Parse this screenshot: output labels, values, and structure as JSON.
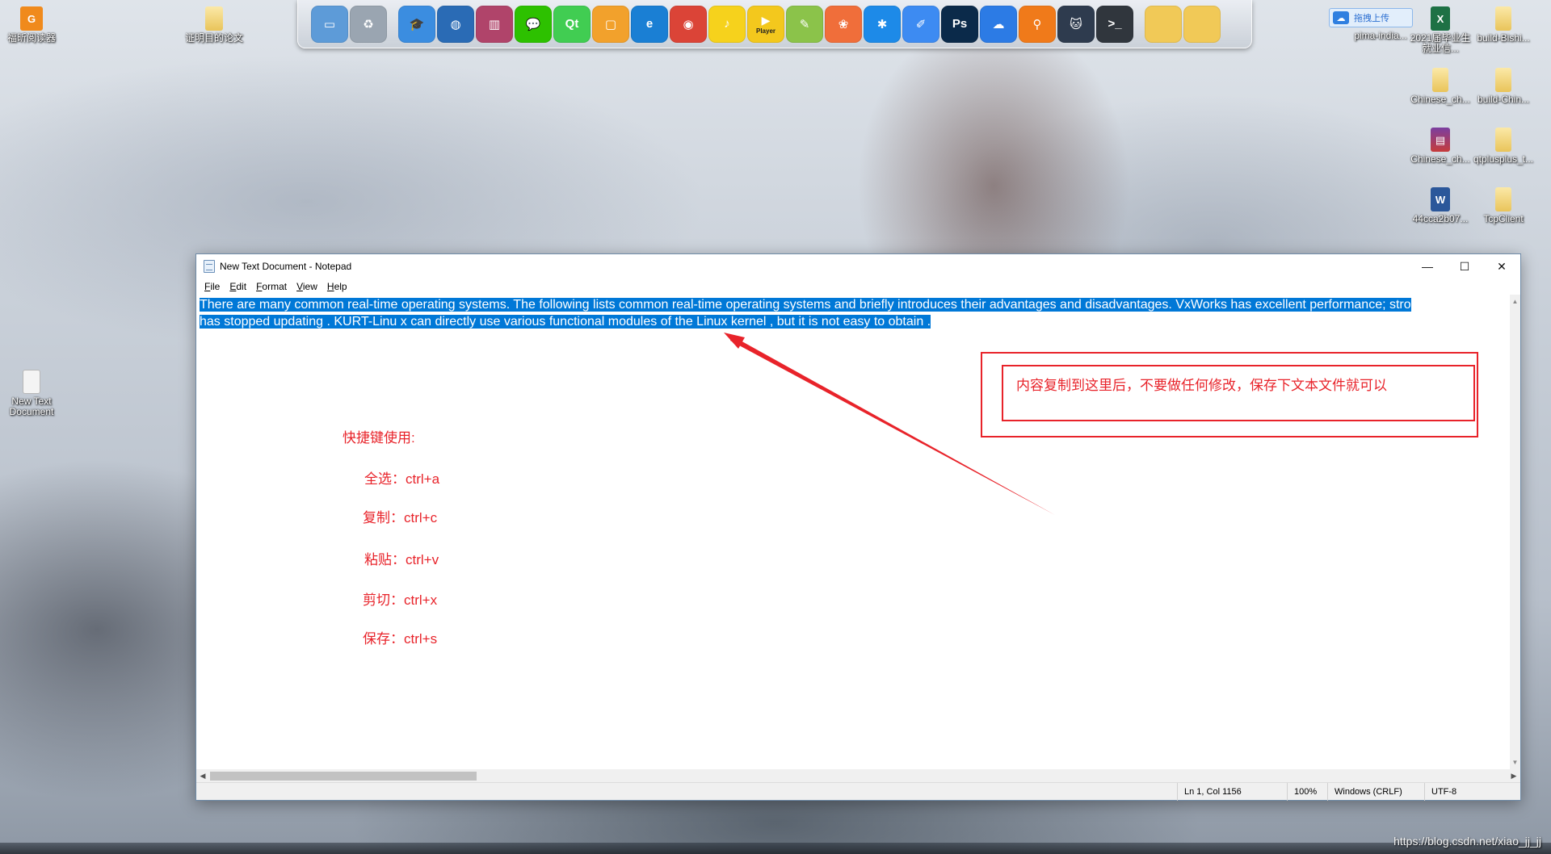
{
  "desktop": {
    "icons_left": [
      {
        "label": "福昕阅读器",
        "glyph": "G",
        "kind": "foxit"
      },
      {
        "label": "证明目的论文",
        "glyph": "",
        "kind": "folder"
      },
      {
        "label": "New Text Document",
        "glyph": "",
        "kind": "doc"
      }
    ],
    "icons_right": [
      {
        "label": "拖拽上传",
        "glyph": "☁",
        "kind": "cloud"
      },
      {
        "label": "pima-india...",
        "glyph": "",
        "kind": "folder"
      },
      {
        "label": "2021届毕业生就业信...",
        "glyph": "X",
        "kind": "excel"
      },
      {
        "label": "build-Bishi...",
        "glyph": "",
        "kind": "folder"
      },
      {
        "label": "Chinese_ch...",
        "glyph": "",
        "kind": "folder"
      },
      {
        "label": "build-Chin...",
        "glyph": "",
        "kind": "folder"
      },
      {
        "label": "Chinese_ch...",
        "glyph": "▤",
        "kind": "rar"
      },
      {
        "label": "qtplusplus_t...",
        "glyph": "",
        "kind": "folder"
      },
      {
        "label": "44cca2b07...",
        "glyph": "W",
        "kind": "word"
      },
      {
        "label": "TcpClient",
        "glyph": "",
        "kind": "folder"
      }
    ]
  },
  "dock": {
    "icons": [
      {
        "name": "computer-icon",
        "glyph": "▭",
        "color": "#5d9bd8"
      },
      {
        "name": "recycle-bin-icon",
        "glyph": "♻",
        "color": "#9aa5b1"
      },
      {
        "name": "sep"
      },
      {
        "name": "graduation-cap-icon",
        "glyph": "🎓",
        "color": "#3b8de0"
      },
      {
        "name": "network-globe-icon",
        "glyph": "◍",
        "color": "#2a6bb5"
      },
      {
        "name": "books-icon",
        "glyph": "▥",
        "color": "#b0446a"
      },
      {
        "name": "wechat-icon",
        "glyph": "💬",
        "color": "#2dc100"
      },
      {
        "name": "qt-icon",
        "glyph": "Qt",
        "color": "#41cd52"
      },
      {
        "name": "box-app-icon",
        "glyph": "▢",
        "color": "#f2a12c"
      },
      {
        "name": "edge-icon",
        "glyph": "e",
        "color": "#1a7fd4"
      },
      {
        "name": "chrome-icon",
        "glyph": "◉",
        "color": "#db4437"
      },
      {
        "name": "music-icon",
        "glyph": "♪",
        "color": "#f6d21c"
      },
      {
        "name": "potplayer-icon",
        "glyph": "▶",
        "color": "#f3c81d",
        "label": "Player"
      },
      {
        "name": "notepadpp-icon",
        "glyph": "✎",
        "color": "#8bc34a"
      },
      {
        "name": "photos-icon",
        "glyph": "❀",
        "color": "#f06e3a"
      },
      {
        "name": "star-app-icon",
        "glyph": "✱",
        "color": "#1d8ae8"
      },
      {
        "name": "pen-app-icon",
        "glyph": "✐",
        "color": "#3d8bf2"
      },
      {
        "name": "photoshop-icon",
        "glyph": "Ps",
        "color": "#0b2a4a"
      },
      {
        "name": "baidu-netdisk-icon",
        "glyph": "☁",
        "color": "#2c7be5"
      },
      {
        "name": "search-magnifier-icon",
        "glyph": "⚲",
        "color": "#f07a1a"
      },
      {
        "name": "cat-icon",
        "glyph": "🐱",
        "color": "#2e3b4e"
      },
      {
        "name": "terminal-icon",
        "glyph": ">_",
        "color": "#30363d"
      },
      {
        "name": "sep"
      },
      {
        "name": "folder-icon",
        "glyph": "",
        "color": "#f1c957"
      },
      {
        "name": "folder-icon",
        "glyph": "",
        "color": "#f1c957"
      }
    ]
  },
  "notepad": {
    "title": "New Text Document - Notepad",
    "menu": [
      {
        "key": "F",
        "rest": "ile"
      },
      {
        "key": "E",
        "rest": "dit"
      },
      {
        "key": "F",
        "rest": "ormat"
      },
      {
        "key": "V",
        "rest": "iew"
      },
      {
        "key": "H",
        "rest": "elp"
      }
    ],
    "content": {
      "line1": "There are many common real-time operating systems. The following lists common real-time operating systems and briefly introduces their advantages and disadvantages. VxWorks has excellent performance; stro",
      "line2": "has stopped updating . KURT-Linu x can directly use various functional modules of the Linux kernel , but it is not easy to obtain ."
    },
    "status": {
      "position": "Ln 1, Col 1156",
      "zoom": "100%",
      "line_ending": "Windows (CRLF)",
      "encoding": "UTF-8"
    }
  },
  "annotations": {
    "note": "内容复制到这里后，不要做任何修改，保存下文本文件就可以",
    "shortcuts_title": "快捷键使用:",
    "shortcuts": [
      "全选：ctrl+a",
      "复制：ctrl+c",
      "粘贴：ctrl+v",
      "剪切：ctrl+x",
      "保存：ctrl+s"
    ],
    "color": "#e8232a"
  },
  "watermark": "https://blog.csdn.net/xiao_jj_jj"
}
